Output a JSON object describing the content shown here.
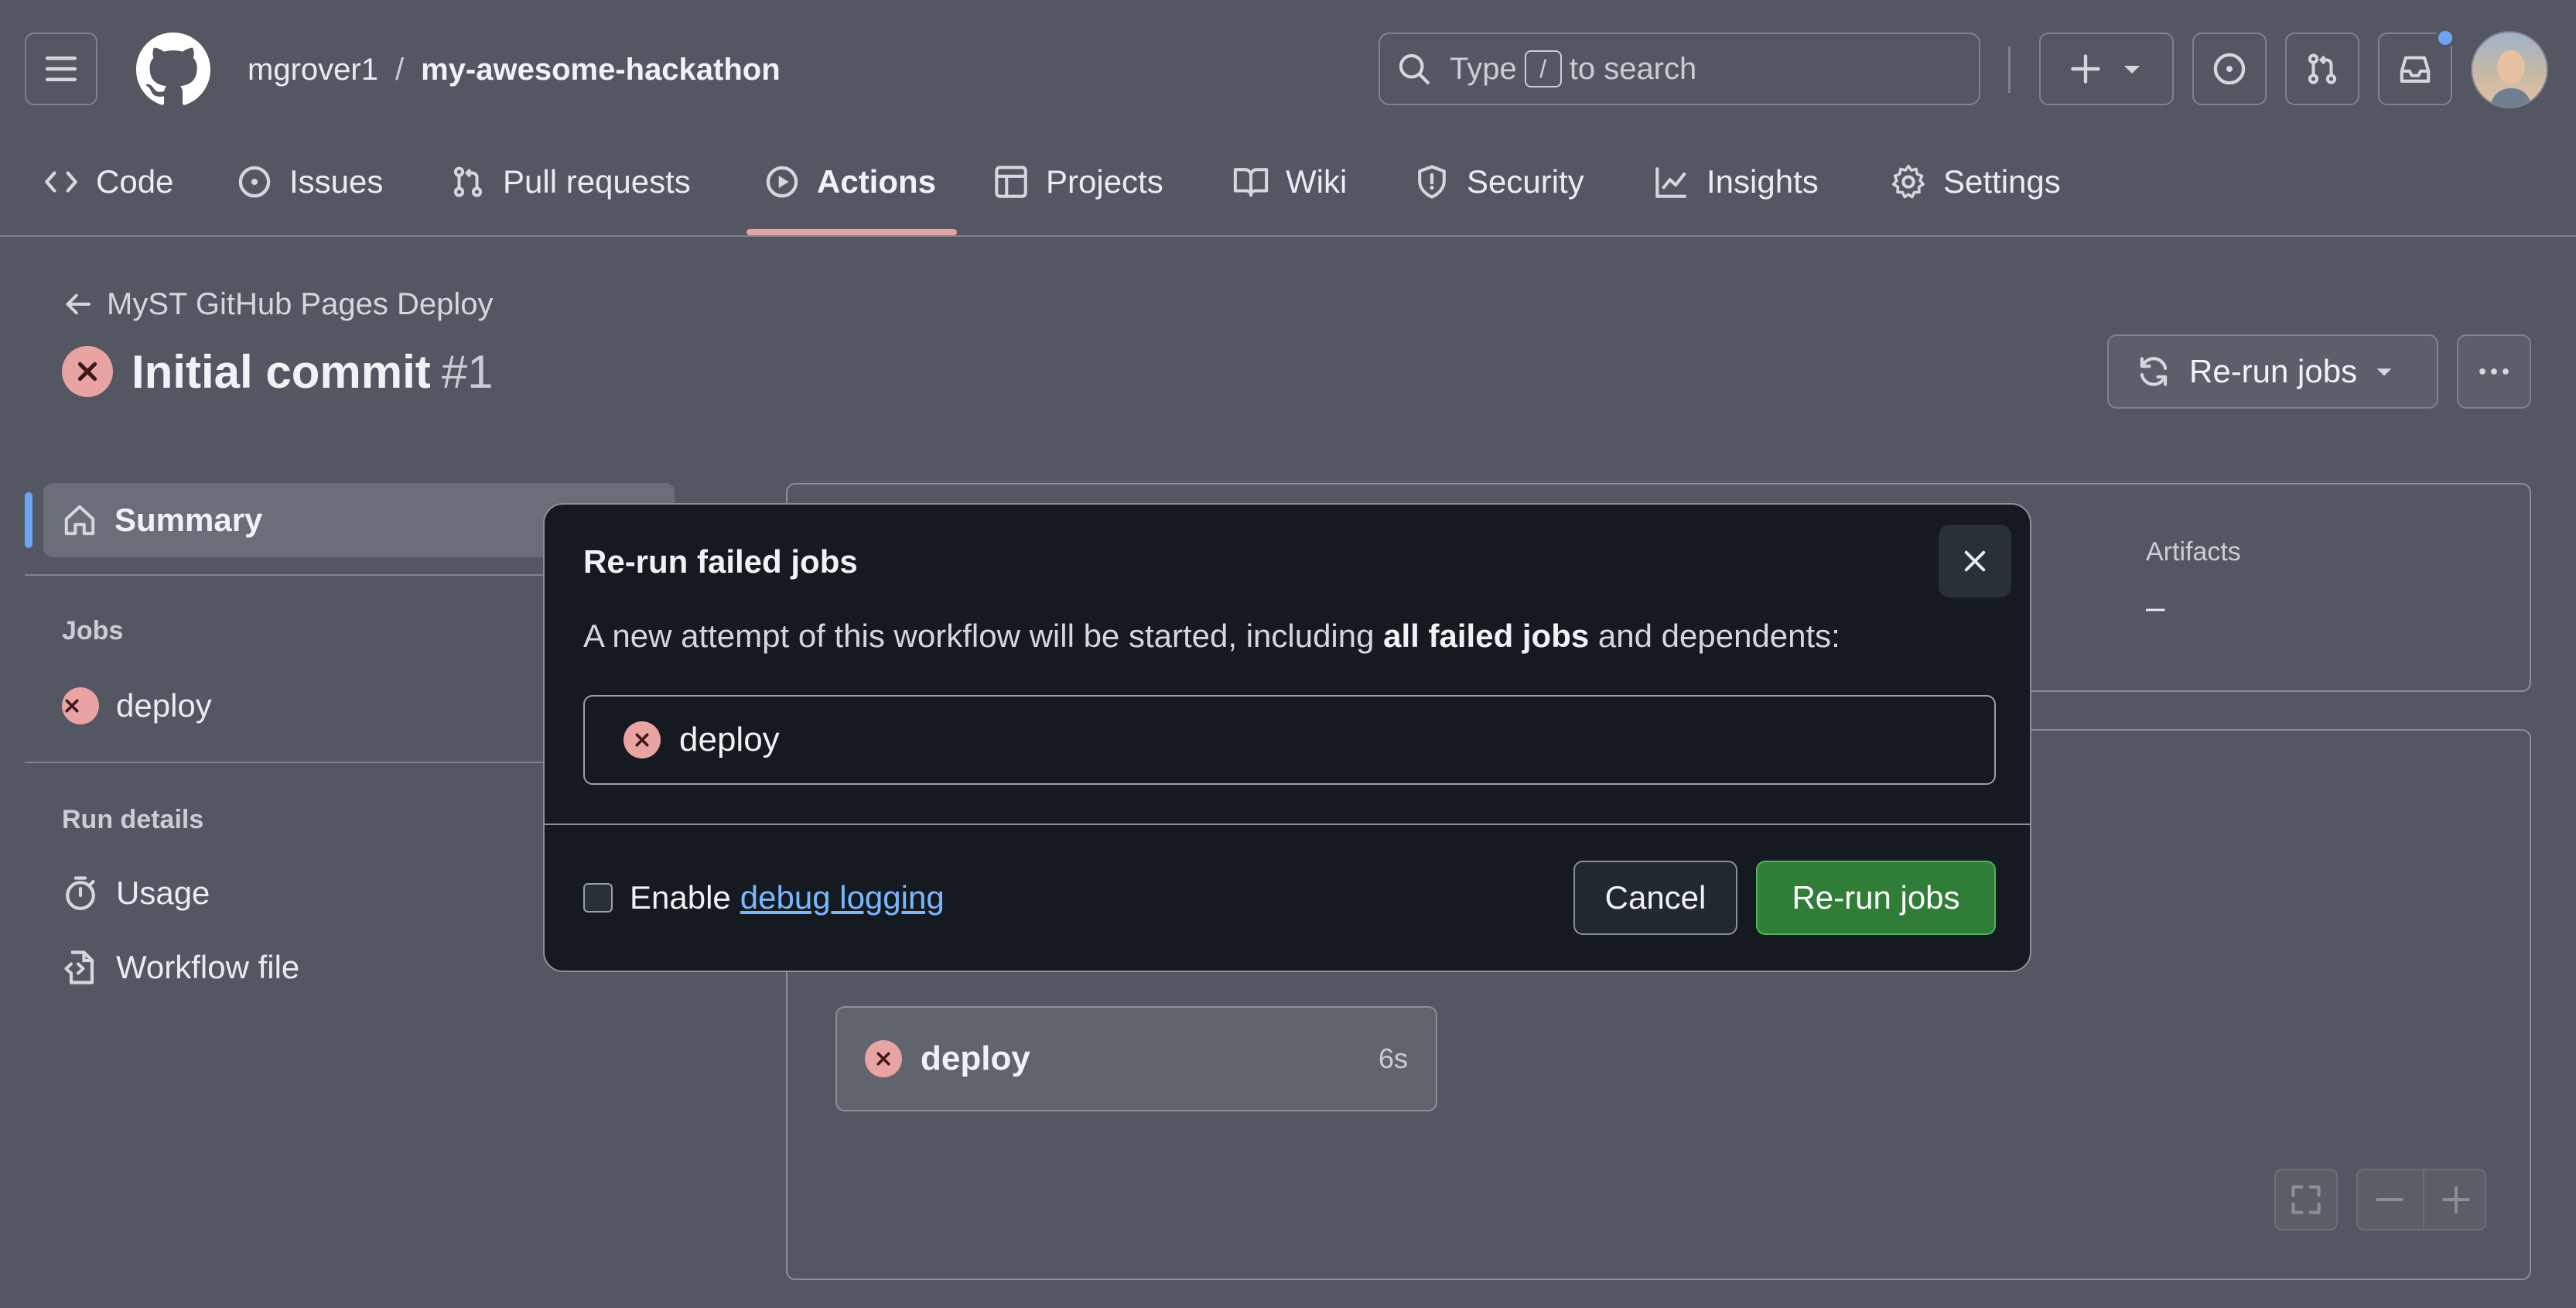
{
  "header": {
    "owner": "mgrover1",
    "separator": "/",
    "repo": "my-awesome-hackathon",
    "search": {
      "pre": "Type",
      "key": "/",
      "post": "to search"
    }
  },
  "nav": {
    "tabs": [
      {
        "label": "Code",
        "icon": "code-icon"
      },
      {
        "label": "Issues",
        "icon": "issue-icon"
      },
      {
        "label": "Pull requests",
        "icon": "pull-request-icon"
      },
      {
        "label": "Actions",
        "icon": "play-icon",
        "active": true
      },
      {
        "label": "Projects",
        "icon": "table-icon"
      },
      {
        "label": "Wiki",
        "icon": "book-icon"
      },
      {
        "label": "Security",
        "icon": "shield-icon"
      },
      {
        "label": "Insights",
        "icon": "graph-icon"
      },
      {
        "label": "Settings",
        "icon": "gear-icon"
      }
    ]
  },
  "run": {
    "back_label": "MyST GitHub Pages Deploy",
    "title": "Initial commit",
    "number": "#1",
    "rerun_label": "Re-run jobs"
  },
  "sidebar": {
    "summary_label": "Summary",
    "jobs_heading": "Jobs",
    "jobs": [
      {
        "label": "deploy",
        "status": "failed"
      }
    ],
    "run_details_heading": "Run details",
    "details": [
      {
        "label": "Usage",
        "icon": "stopwatch-icon"
      },
      {
        "label": "Workflow file",
        "icon": "file-code-icon"
      }
    ]
  },
  "main": {
    "artifacts_label": "Artifacts",
    "artifacts_value": "–",
    "job_card": {
      "label": "deploy",
      "duration": "6s"
    }
  },
  "modal": {
    "title": "Re-run failed jobs",
    "desc_pre": "A new attempt of this workflow will be started, including ",
    "desc_bold": "all failed jobs",
    "desc_post": " and dependents:",
    "job": "deploy",
    "debug_pre": "Enable",
    "debug_link": "debug logging",
    "cancel_label": "Cancel",
    "confirm_label": "Re-run jobs"
  },
  "colors": {
    "page_bg": "#545761",
    "modal_bg": "#151a21",
    "fail": "#e9a3a3",
    "primary_green": "#2f7d36",
    "link": "#79b8ff",
    "active_underline": "#e6a3a3",
    "selection_bar": "#6aa4f5"
  }
}
